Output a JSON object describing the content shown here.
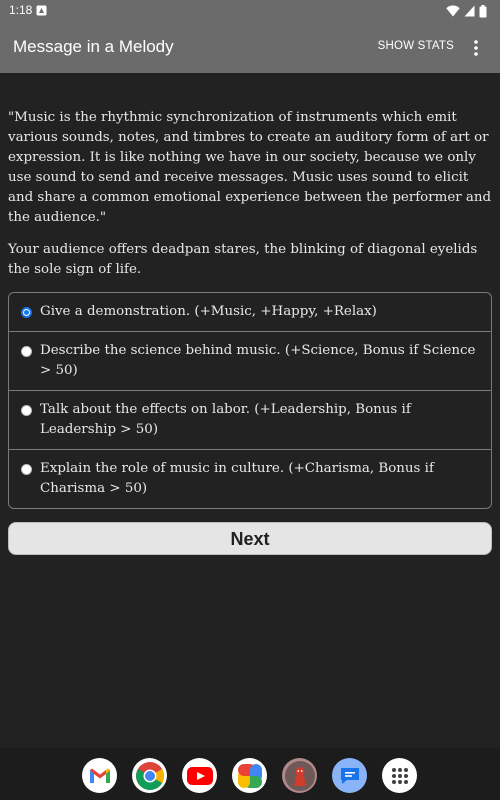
{
  "status_bar": {
    "time": "1:18"
  },
  "app_bar": {
    "title": "Message in a Melody",
    "show_stats_label": "SHOW STATS"
  },
  "story": {
    "paragraph_1": "\"Music is the rhythmic synchronization of instruments which emit various sounds, notes, and timbres to create an auditory form of art or expression. It is like nothing we have in our society, because we only use sound to send and receive messages. Music uses sound to elicit and share a common emotional experience between the performer and the audience.\"",
    "paragraph_2": "Your audience offers deadpan stares, the blinking of diagonal eyelids the sole sign of life."
  },
  "choices": [
    {
      "label": "Give a demonstration. (+Music, +Happy, +Relax)",
      "selected": true
    },
    {
      "label": "Describe the science behind music. (+Science, Bonus if Science > 50)",
      "selected": false
    },
    {
      "label": "Talk about the effects on labor. (+Leadership, Bonus if Leadership > 50)",
      "selected": false
    },
    {
      "label": "Explain the role of music in culture. (+Charisma, Bonus if Charisma > 50)",
      "selected": false
    }
  ],
  "next_button_label": "Next",
  "dock": {
    "apps": [
      "gmail-icon",
      "chrome-icon",
      "youtube-icon",
      "photos-icon",
      "game-app-icon",
      "messages-icon",
      "app-drawer-icon"
    ]
  },
  "colors": {
    "background": "#222222",
    "app_bar": "#6b6b6b",
    "accent": "#1a73e8"
  }
}
